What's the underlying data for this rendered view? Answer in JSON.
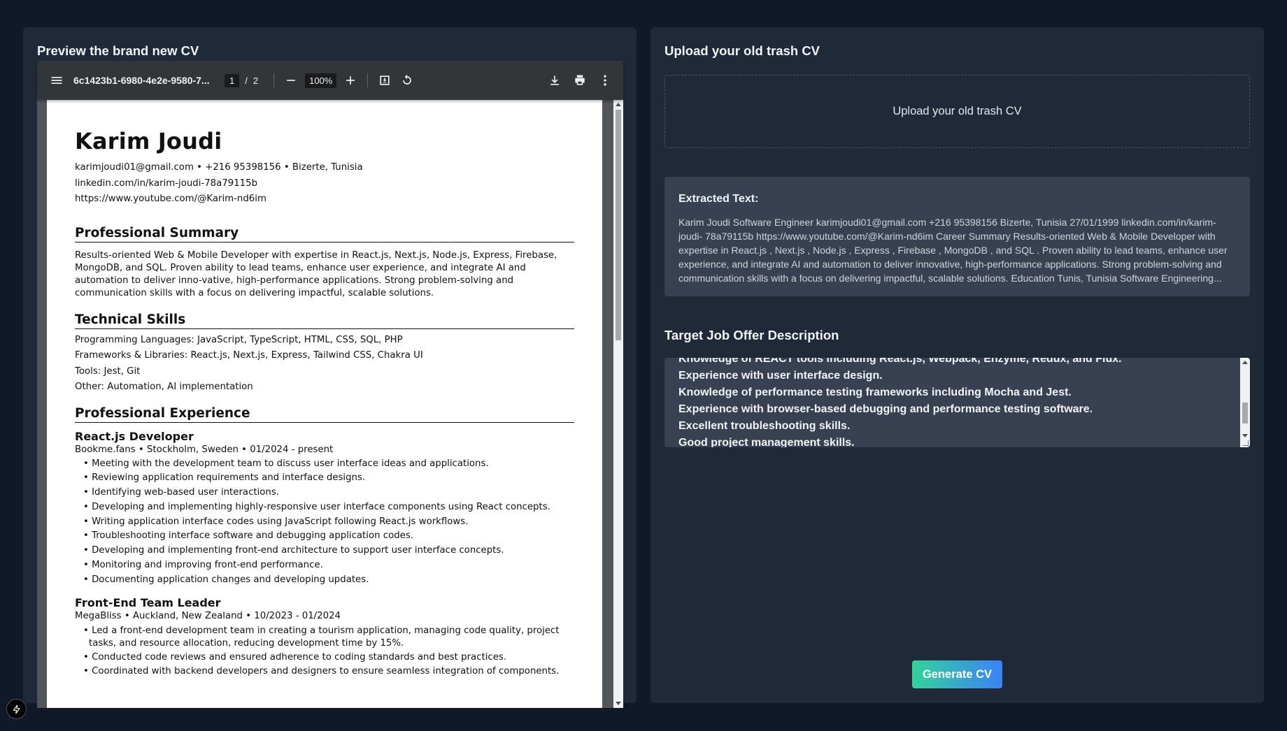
{
  "left_panel": {
    "title": "Preview the brand new CV"
  },
  "pdf_viewer": {
    "filename": "6c1423b1-6980-4e2e-9580-7...",
    "current_page": "1",
    "page_separator": "/",
    "total_pages": "2",
    "zoom": "100%"
  },
  "cv": {
    "name": "Karim Joudi",
    "contact_line1": "karimjoudi01@gmail.com • +216 95398156 • Bizerte, Tunisia",
    "contact_line2": "linkedin.com/in/karim-joudi-78a79115b",
    "contact_line3": "https://www.youtube.com/@Karim-nd6im",
    "summary_heading": "Professional Summary",
    "summary_text": "Results-oriented Web & Mobile Developer with expertise in React.js, Next.js, Node.js, Express, Firebase, MongoDB, and SQL. Proven ability to lead teams, enhance user experience, and integrate AI and automation to deliver inno-vative, high-performance applications. Strong problem-solving and communication skills with a focus on delivering impactful, scalable solutions.",
    "skills_heading": "Technical Skills",
    "skills": [
      "Programming Languages: JavaScript, TypeScript, HTML, CSS, SQL, PHP",
      "Frameworks & Libraries: React.js, Next.js, Express, Tailwind CSS, Chakra UI",
      "Tools: Jest, Git",
      "Other: Automation, AI implementation"
    ],
    "experience_heading": "Professional Experience",
    "job1": {
      "role": "React.js Developer",
      "meta": "Bookme.fans • Stockholm, Sweden • 01/2024 - present",
      "bullets": [
        "• Meeting with the development team to discuss user interface ideas and applications.",
        "• Reviewing application requirements and interface designs.",
        "• Identifying web-based user interactions.",
        "• Developing and implementing highly-responsive user interface components using React concepts.",
        "• Writing application interface codes using JavaScript following React.js workflows.",
        "• Troubleshooting interface software and debugging application codes.",
        "• Developing and implementing front-end architecture to support user interface concepts.",
        "• Monitoring and improving front-end performance.",
        "• Documenting application changes and developing updates."
      ]
    },
    "job2": {
      "role": "Front-End Team Leader",
      "meta": "MegaBliss • Auckland, New Zealand • 10/2023 - 01/2024",
      "bullets": [
        "• Led a front-end development team in creating a tourism application, managing code quality, project tasks, and resource allocation, reducing development time by 15%.",
        "• Conducted code reviews and ensured adherence to coding standards and best practices.",
        "• Coordinated with backend developers and designers to ensure seamless integration of components."
      ]
    }
  },
  "right_panel": {
    "title": "Upload your old trash CV",
    "upload_label": "Upload your old trash CV",
    "extracted_title": "Extracted Text:",
    "extracted_text": "Karim Joudi Software Engineer karimjoudi01@gmail.com +216 95398156 Bizerte, Tunisia 27/01/1999 linkedin.com/in/karim-joudi- 78a79115b https://www.youtube.com/@Karim-nd6im Career Summary Results-oriented Web & Mobile Developer with expertise in React.js , Next.js , Node.js , Express , Firebase , MongoDB , and SQL . Proven ability to lead teams, enhance user experience, and integrate AI and automation to deliver innovative, high-performance applications. Strong problem-solving and communication skills with a focus on delivering impactful, scalable solutions. Education Tunis, Tunisia Software Engineering...",
    "job_title": "Target Job Offer Description",
    "job_lines": [
      "Knowledge of REACT tools including React.js, Webpack, Enzyme, Redux, and Flux.",
      "Experience with user interface design.",
      "Knowledge of performance testing frameworks including Mocha and Jest.",
      "Experience with browser-based debugging and performance testing software.",
      "Excellent troubleshooting skills.",
      "Good project management skills."
    ],
    "generate_label": "Generate CV"
  },
  "icons": {
    "menu": "menu-icon",
    "zoom_out": "minus-icon",
    "zoom_in": "plus-icon",
    "fit": "fit-page-icon",
    "rotate": "rotate-icon",
    "download": "download-icon",
    "print": "print-icon",
    "more": "more-vert-icon",
    "badge": "lightning-icon"
  },
  "colors": {
    "background": "#111827",
    "panel": "#1f2937",
    "card": "#374151",
    "button_gradient_start": "#34d399",
    "button_gradient_end": "#3b82f6"
  }
}
